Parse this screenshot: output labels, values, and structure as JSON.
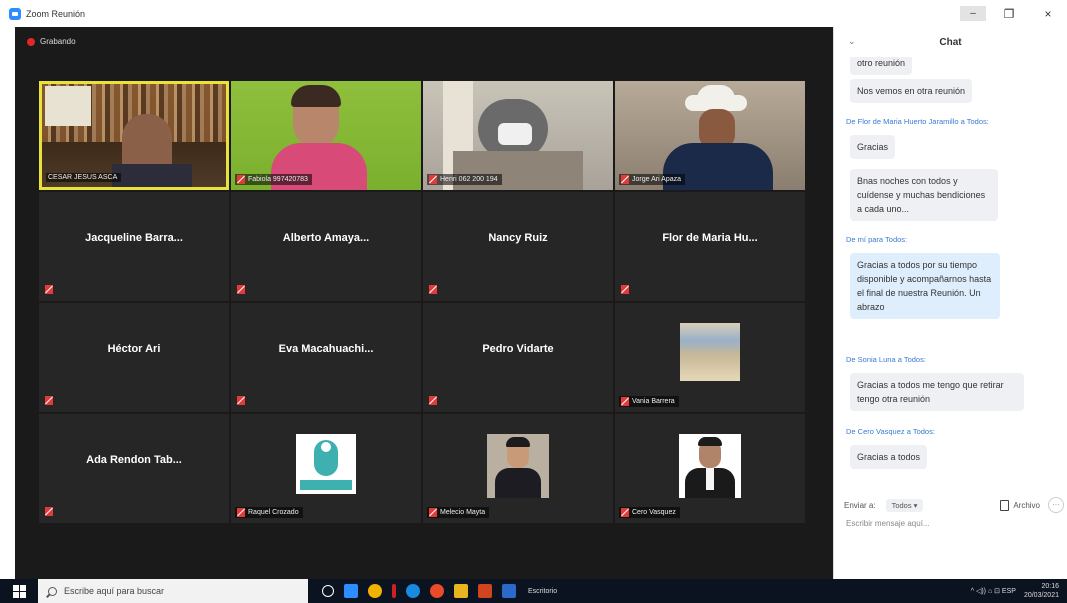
{
  "window": {
    "title": "Zoom Reunión",
    "min_label": "–",
    "max_label": "❐",
    "close_label": "×"
  },
  "recording": {
    "label": "Grabando"
  },
  "tiles": [
    {
      "name": "CESAR JESUS ASCA",
      "big": ""
    },
    {
      "name": "Fabiola 997420783",
      "big": ""
    },
    {
      "name": "Henri 062 200 194",
      "big": ""
    },
    {
      "name": "Jorge Ari Apaza",
      "big": ""
    },
    {
      "name": "",
      "big": "Jacqueline Barra..."
    },
    {
      "name": "",
      "big": "Alberto Amaya..."
    },
    {
      "name": "",
      "big": "Nancy Ruiz"
    },
    {
      "name": "",
      "big": "Flor de Maria Hu..."
    },
    {
      "name": "",
      "big": "Héctor Ari"
    },
    {
      "name": "",
      "big": "Eva Macahuachi..."
    },
    {
      "name": "",
      "big": "Pedro Vidarte"
    },
    {
      "name": "Vania Barrera",
      "big": ""
    },
    {
      "name": "",
      "big": "Ada Rendon Tab..."
    },
    {
      "name": "Raquel Crozado",
      "big": ""
    },
    {
      "name": "Melecio Mayta",
      "big": ""
    },
    {
      "name": "Cero Vasquez",
      "big": ""
    }
  ],
  "chat": {
    "title": "Chat",
    "collapse_icon": "⌄",
    "messages": [
      {
        "sender": "",
        "text": "otro reunión"
      },
      {
        "sender": "",
        "text": "Nos vemos en otra reunión"
      },
      {
        "sender": "De Flor de Maria Huerto Jaramillo a Todos:",
        "text": "Gracias"
      },
      {
        "sender": "",
        "text": "Bnas noches con todos y cuídense y muchas bendiciones a cada uno..."
      },
      {
        "sender": "De mí para Todos:",
        "text": "Gracias a todos por su tiempo disponible y acompañarnos hasta el final de nuestra Reunión. Un abrazo"
      },
      {
        "sender": "De Sonia Luna a Todos:",
        "text": "Gracias a todos me tengo que retirar tengo otra reunión"
      },
      {
        "sender": "De Cero Vasquez a Todos:",
        "text": "Gracias a todos"
      }
    ],
    "send_to_label": "Enviar a:",
    "send_to_value": "Todos ▾",
    "file_label": "Archivo",
    "more_label": "···",
    "input_placeholder": "Escribir mensaje aquí..."
  },
  "taskbar": {
    "search_placeholder": "Escribe aquí para buscar",
    "status_text": "Escritorio",
    "tray_text": "^ ◁)) ⌂ ⊡ ESP",
    "time": "20:16",
    "date": "20/03/2021"
  }
}
